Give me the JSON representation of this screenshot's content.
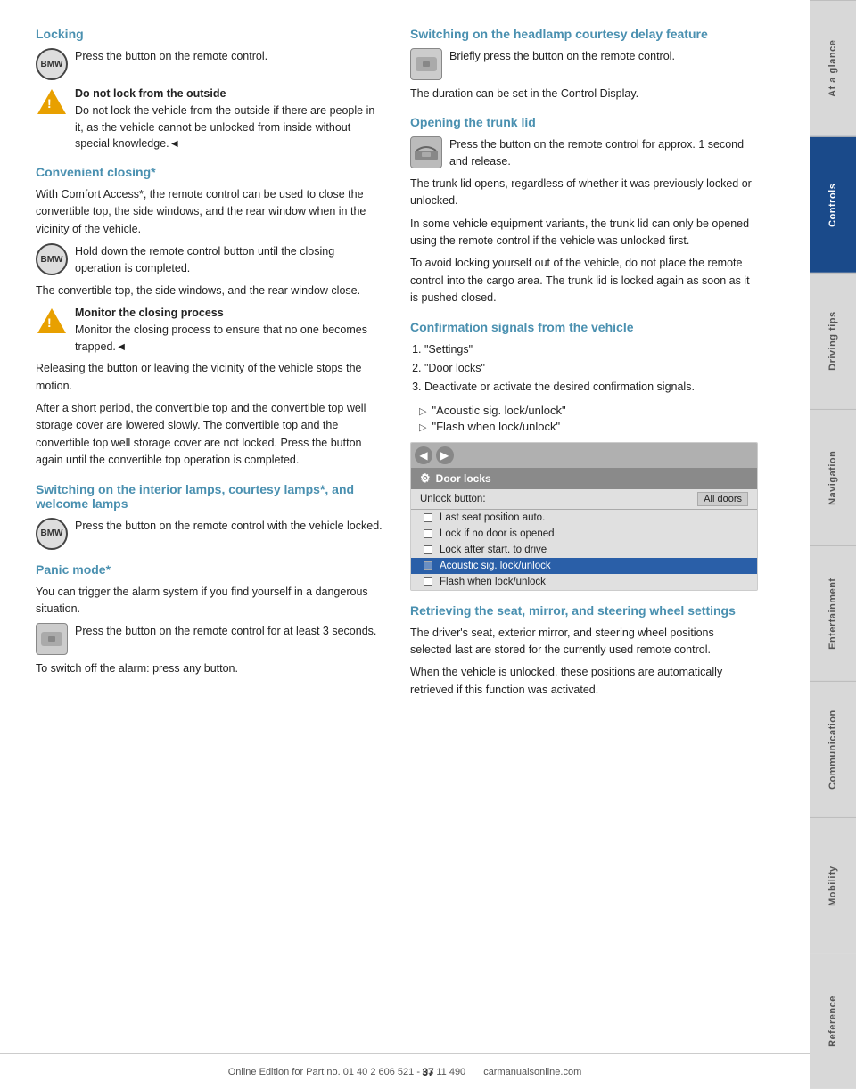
{
  "sidebar": {
    "tabs": [
      {
        "id": "at-a-glance",
        "label": "At a glance",
        "active": false
      },
      {
        "id": "controls",
        "label": "Controls",
        "active": true
      },
      {
        "id": "driving-tips",
        "label": "Driving tips",
        "active": false
      },
      {
        "id": "navigation",
        "label": "Navigation",
        "active": false
      },
      {
        "id": "entertainment",
        "label": "Entertainment",
        "active": false
      },
      {
        "id": "communication",
        "label": "Communication",
        "active": false
      },
      {
        "id": "mobility",
        "label": "Mobility",
        "active": false
      },
      {
        "id": "reference",
        "label": "Reference",
        "active": false
      }
    ]
  },
  "left_col": {
    "locking": {
      "title": "Locking",
      "press_button_text": "Press the button on the remote control.",
      "warning_title": "Do not lock from the outside",
      "warning_text": "Do not lock the vehicle from the outside if there are people in it, as the vehicle cannot be unlocked from inside without special knowledge.◄"
    },
    "convenient_closing": {
      "title": "Convenient closing*",
      "intro": "With Comfort Access*, the remote control can be used to close the convertible top, the side windows, and the rear window when in the vicinity of the vehicle.",
      "hold_text": "Hold down the remote control button until the closing operation is completed.",
      "result_text": "The convertible top, the side windows, and the rear window close.",
      "monitor_title": "Monitor the closing process",
      "monitor_text": "Monitor the closing process to ensure that no one becomes trapped.◄",
      "releasing_text": "Releasing the button or leaving the vicinity of the vehicle stops the motion.",
      "after_short_text": "After a short period, the convertible top and the convertible top well storage cover are lowered slowly. The convertible top and the convertible top well storage cover are not locked. Press the button again until the convertible top operation is completed."
    },
    "switching_interior": {
      "title": "Switching on the interior lamps, courtesy lamps*, and welcome lamps",
      "press_text": "Press the button on the remote control with the vehicle locked."
    },
    "panic_mode": {
      "title": "Panic mode*",
      "intro": "You can trigger the alarm system if you find yourself in a dangerous situation.",
      "press_text": "Press the button on the remote control for at least 3 seconds.",
      "switch_off": "To switch off the alarm: press any button."
    }
  },
  "right_col": {
    "headlamp_courtesy": {
      "title": "Switching on the headlamp courtesy delay feature",
      "press_text": "Briefly press the button on the remote control.",
      "duration_text": "The duration can be set in the Control Display."
    },
    "opening_trunk": {
      "title": "Opening the trunk lid",
      "press_text": "Press the button on the remote control for approx. 1 second and release.",
      "trunk_text1": "The trunk lid opens, regardless of whether it was previously locked or unlocked.",
      "trunk_text2": "In some vehicle equipment variants, the trunk lid can only be opened using the remote control if the vehicle was unlocked first.",
      "trunk_text3": "To avoid locking yourself out of the vehicle, do not place the remote control into the cargo area. The trunk lid is locked again as soon as it is pushed closed."
    },
    "confirmation_signals": {
      "title": "Confirmation signals from the vehicle",
      "steps": [
        {
          "num": "1.",
          "text": "\"Settings\""
        },
        {
          "num": "2.",
          "text": "\"Door locks\""
        },
        {
          "num": "3.",
          "text": "Deactivate or activate the desired confirmation signals."
        }
      ],
      "bullets": [
        "\"Acoustic sig. lock/unlock\"",
        "\"Flash when lock/unlock\""
      ],
      "screen": {
        "title": "Door locks",
        "unlock_label": "Unlock button:",
        "unlock_value": "All doors",
        "rows": [
          {
            "label": "Last seat position auto.",
            "highlighted": false
          },
          {
            "label": "Lock if no door is opened",
            "highlighted": false
          },
          {
            "label": "Lock after start. to drive",
            "highlighted": false
          },
          {
            "label": "Acoustic sig. lock/unlock",
            "highlighted": true
          },
          {
            "label": "Flash when lock/unlock",
            "highlighted": false
          }
        ]
      }
    },
    "retrieving_seat": {
      "title": "Retrieving the seat, mirror, and steering wheel settings",
      "text1": "The driver's seat, exterior mirror, and steering wheel positions selected last are stored for the currently used remote control.",
      "text2": "When the vehicle is unlocked, these positions are automatically retrieved if this function was activated."
    }
  },
  "footer": {
    "page_number": "37",
    "footer_text": "Online Edition for Part no. 01 40 2 606 521 - 03 11 490",
    "brand": "carmanualsonline.com"
  }
}
